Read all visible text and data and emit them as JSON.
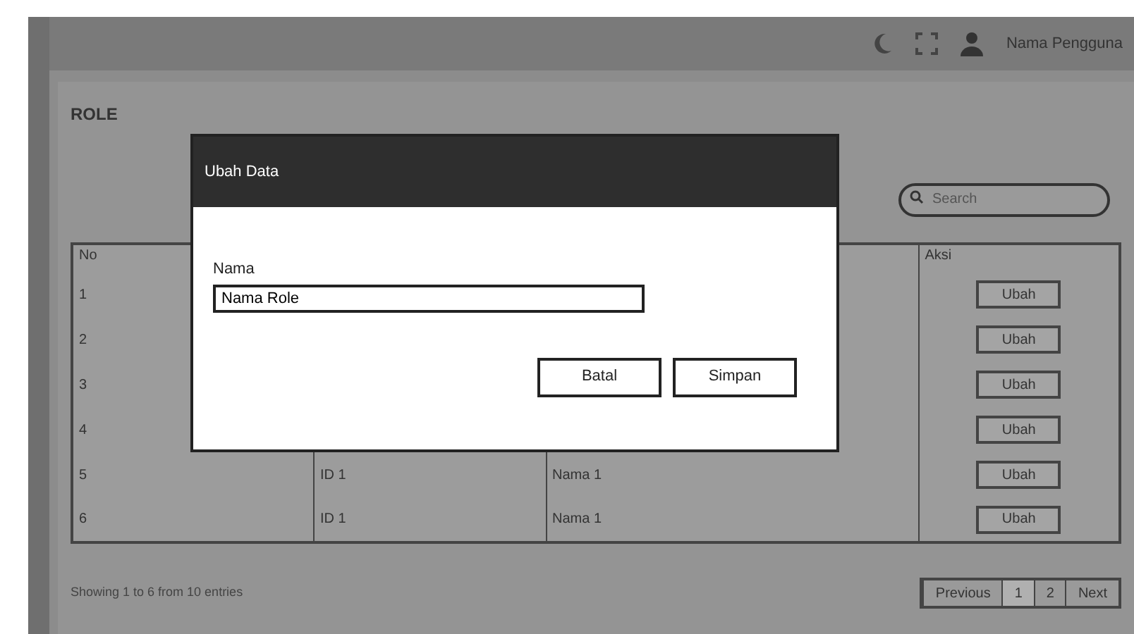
{
  "header": {
    "user_name": "Nama Pengguna"
  },
  "page": {
    "title": "ROLE",
    "search": {
      "placeholder": "Search"
    }
  },
  "table": {
    "columns": [
      "No",
      "",
      "",
      "Aksi"
    ],
    "rows": [
      {
        "no": "1",
        "id": "",
        "nama": "",
        "action": "Ubah"
      },
      {
        "no": "2",
        "id": "",
        "nama": "",
        "action": "Ubah"
      },
      {
        "no": "3",
        "id": "",
        "nama": "",
        "action": "Ubah"
      },
      {
        "no": "4",
        "id": "",
        "nama": "",
        "action": "Ubah"
      },
      {
        "no": "5",
        "id": "ID 1",
        "nama": "Nama 1",
        "action": "Ubah"
      },
      {
        "no": "6",
        "id": "ID 1",
        "nama": "Nama 1",
        "action": "Ubah"
      }
    ]
  },
  "footer": {
    "info": "Showing 1 to 6 from 10 entries",
    "pages": [
      {
        "label": "Previous",
        "selected": false
      },
      {
        "label": "1",
        "selected": true
      },
      {
        "label": "2",
        "selected": false
      },
      {
        "label": "Next",
        "selected": false
      }
    ]
  },
  "modal": {
    "title": "Ubah Data",
    "field_label": "Nama",
    "field_value": "Nama Role",
    "buttons": [
      "Batal",
      "Simpan"
    ]
  }
}
